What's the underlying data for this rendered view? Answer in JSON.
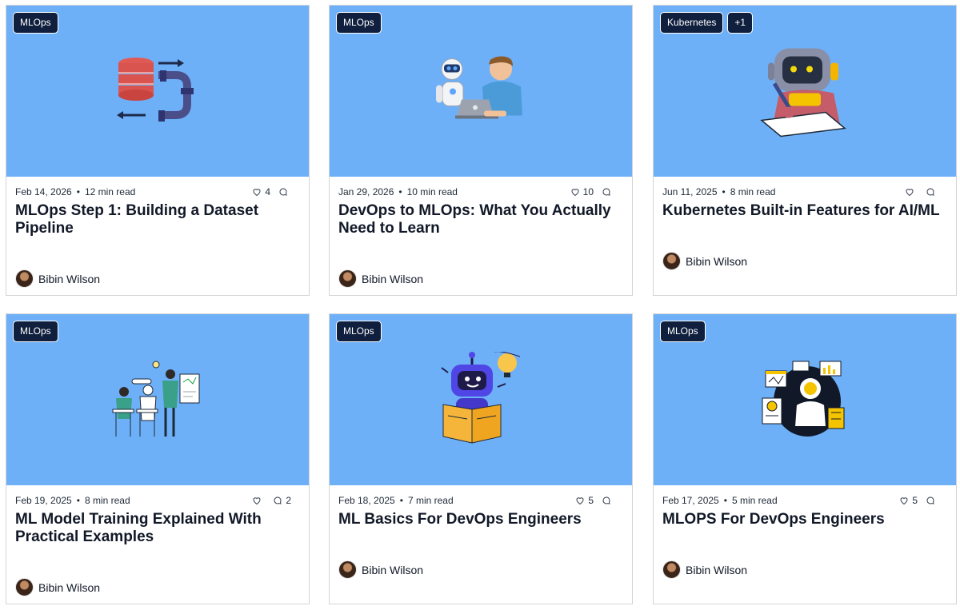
{
  "posts": [
    {
      "tags": [
        "MLOps"
      ],
      "date": "Feb 14, 2026",
      "read_time": "12 min read",
      "likes": "4",
      "comments": "",
      "title": "MLOps Step 1: Building a Dataset Pipeline",
      "author": "Bibin Wilson",
      "illustration": "database-pipeline"
    },
    {
      "tags": [
        "MLOps"
      ],
      "date": "Jan 29, 2026",
      "read_time": "10 min read",
      "likes": "10",
      "comments": "",
      "title": "DevOps to MLOps: What You Actually Need to Learn",
      "author": "Bibin Wilson",
      "illustration": "robot-and-person-laptop"
    },
    {
      "tags": [
        "Kubernetes",
        "+1"
      ],
      "date": "Jun 11, 2025",
      "read_time": "8 min read",
      "likes": "",
      "comments": "",
      "title": "Kubernetes Built-in Features for AI/ML",
      "author": "Bibin Wilson",
      "illustration": "robot-writing"
    },
    {
      "tags": [
        "MLOps"
      ],
      "date": "Feb 19, 2025",
      "read_time": "8 min read",
      "likes": "",
      "comments": "2",
      "title": "ML Model Training Explained With Practical Examples",
      "author": "Bibin Wilson",
      "illustration": "classroom-presentation"
    },
    {
      "tags": [
        "MLOps"
      ],
      "date": "Feb 18, 2025",
      "read_time": "7 min read",
      "likes": "5",
      "comments": "",
      "title": "ML Basics For DevOps Engineers",
      "author": "Bibin Wilson",
      "illustration": "robot-reading-book"
    },
    {
      "tags": [
        "MLOps"
      ],
      "date": "Feb 17, 2025",
      "read_time": "5 min read",
      "likes": "5",
      "comments": "",
      "title": "MLOPS For DevOps Engineers",
      "author": "Bibin Wilson",
      "illustration": "astronaut-dashboards"
    }
  ],
  "colors": {
    "thumbnail_bg": "#6eb0f8",
    "tag_bg": "#0f1f3d",
    "title_text": "#111827"
  },
  "icons": {
    "likes": "heart-icon",
    "comments": "comment-icon"
  }
}
